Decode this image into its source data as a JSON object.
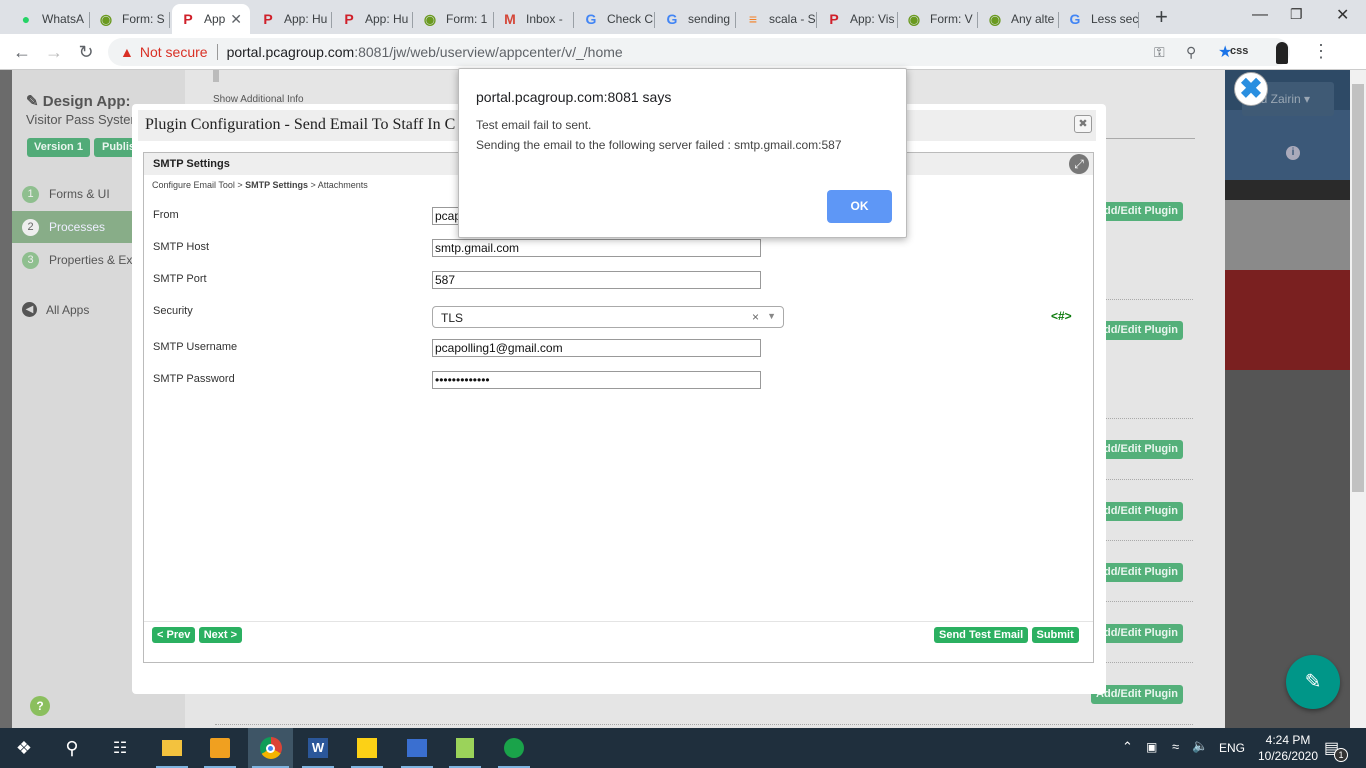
{
  "browser": {
    "tabs": [
      {
        "label": "WhatsA",
        "icon": "whatsapp-icon"
      },
      {
        "label": "Form: S",
        "icon": "joget-icon"
      },
      {
        "label": "App",
        "icon": "pca-icon",
        "active": true
      },
      {
        "label": "App: Hu",
        "icon": "pca-icon"
      },
      {
        "label": "App: Hu",
        "icon": "pca-icon"
      },
      {
        "label": "Form: 1",
        "icon": "joget-icon"
      },
      {
        "label": "Inbox -",
        "icon": "gmail-icon"
      },
      {
        "label": "Check C",
        "icon": "google-icon"
      },
      {
        "label": "sending",
        "icon": "google-icon"
      },
      {
        "label": "scala - S",
        "icon": "stackoverflow-icon"
      },
      {
        "label": "App: Vis",
        "icon": "pca-icon"
      },
      {
        "label": "Form: V",
        "icon": "joget-icon"
      },
      {
        "label": "Any alte",
        "icon": "joget-icon"
      },
      {
        "label": "Less sec",
        "icon": "google-icon"
      }
    ],
    "new_tab": "+",
    "security_label": "Not secure",
    "url_host": "portal.pcagroup.com",
    "url_rest": ":8081/jw/web/userview/appcenter/v/_/home",
    "ext_label": "css"
  },
  "sidebar": {
    "title": "Design App:",
    "subtitle": "Visitor Pass Syster",
    "version_btn": "Version 1",
    "publish_btn": "Publis",
    "items": [
      {
        "num": "1",
        "label": "Forms & UI"
      },
      {
        "num": "2",
        "label": "Processes"
      },
      {
        "num": "3",
        "label": "Properties & Exp"
      }
    ],
    "all_apps": "All Apps"
  },
  "main": {
    "show_info": "Show Additional Info",
    "add_edit_label": "Add/Edit Plugin",
    "user_label": "ad Zairin"
  },
  "modal": {
    "title": "Plugin Configuration - Send Email To Staff In C",
    "section": "SMTP Settings",
    "breadcrumb": {
      "step1": "Configure Email Tool >",
      "step2": "SMTP Settings",
      "step3": "> Attachments"
    },
    "fields": [
      {
        "label": "From",
        "value": "pcap"
      },
      {
        "label": "SMTP Host",
        "value": "smtp.gmail.com"
      },
      {
        "label": "SMTP Port",
        "value": "587"
      },
      {
        "label": "Security",
        "value": "TLS"
      },
      {
        "label": "SMTP Username",
        "value": "pcapolling1@gmail.com"
      },
      {
        "label": "SMTP Password",
        "value": "•••••••••••••"
      }
    ],
    "hash_label": "<#>",
    "prev": "< Prev",
    "next": "Next >",
    "send_test": "Send Test Email",
    "submit": "Submit"
  },
  "alert": {
    "title": "portal.pcagroup.com:8081 says",
    "line1": "Test email fail to sent.",
    "line2": "Sending the email to the following server failed : smtp.gmail.com:587",
    "ok": "OK"
  },
  "taskbar": {
    "time": "4:24 PM",
    "date": "10/26/2020",
    "lang": "ENG",
    "notif_count": "1"
  },
  "colors": {
    "green": "#2bb061",
    "ok_blue": "#5e97f6",
    "teal": "#009688"
  }
}
